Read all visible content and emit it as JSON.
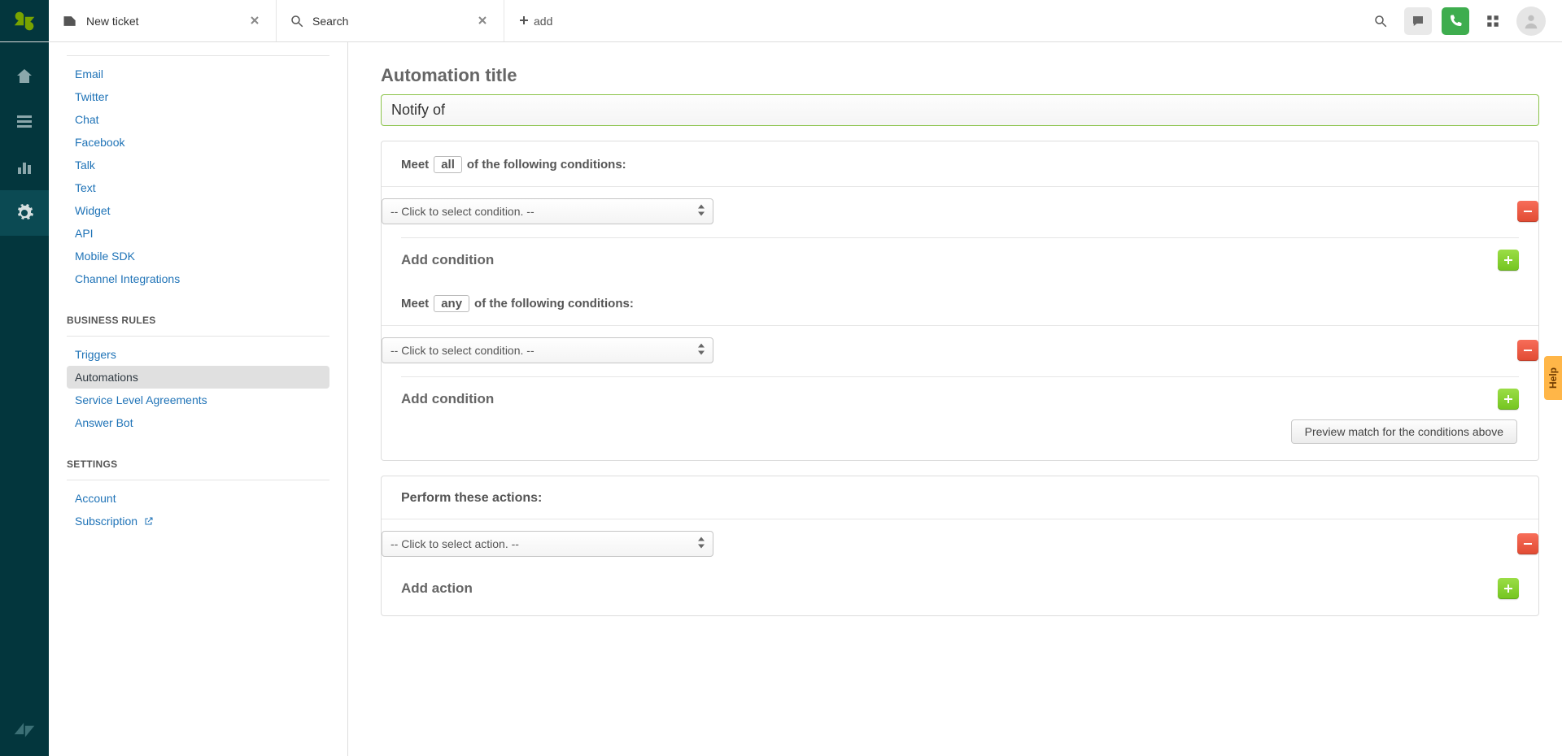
{
  "header": {
    "tabs": [
      {
        "label": "New ticket",
        "icon": "ticket-icon"
      },
      {
        "label": "Search",
        "icon": "search-icon"
      }
    ],
    "add_label": "add"
  },
  "sidebar": {
    "channels": {
      "items": [
        {
          "label": "Email"
        },
        {
          "label": "Twitter"
        },
        {
          "label": "Chat"
        },
        {
          "label": "Facebook"
        },
        {
          "label": "Talk"
        },
        {
          "label": "Text"
        },
        {
          "label": "Widget"
        },
        {
          "label": "API"
        },
        {
          "label": "Mobile SDK"
        },
        {
          "label": "Channel Integrations"
        }
      ]
    },
    "business_rules": {
      "title": "BUSINESS RULES",
      "items": [
        {
          "label": "Triggers"
        },
        {
          "label": "Automations",
          "active": true
        },
        {
          "label": "Service Level Agreements"
        },
        {
          "label": "Answer Bot"
        }
      ]
    },
    "settings": {
      "title": "SETTINGS",
      "items": [
        {
          "label": "Account"
        },
        {
          "label": "Subscription",
          "external": true
        }
      ]
    }
  },
  "main": {
    "automation_title_label": "Automation title",
    "automation_title_value": "Notify of ",
    "conditions_all": {
      "meet_pre": "Meet",
      "qualifier": "all",
      "meet_post": "of the following conditions:",
      "select_placeholder": "-- Click to select condition. --",
      "add_label": "Add condition"
    },
    "conditions_any": {
      "meet_pre": "Meet",
      "qualifier": "any",
      "meet_post": "of the following conditions:",
      "select_placeholder": "-- Click to select condition. --",
      "add_label": "Add condition"
    },
    "preview_label": "Preview match for the conditions above",
    "actions": {
      "heading": "Perform these actions:",
      "select_placeholder": "-- Click to select action. --",
      "add_label": "Add action"
    }
  },
  "help_tab": "Help"
}
